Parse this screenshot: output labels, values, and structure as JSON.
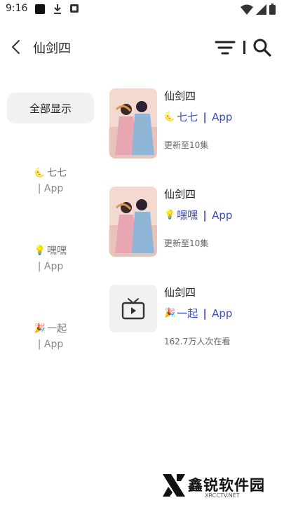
{
  "status_bar": {
    "time": "9:16"
  },
  "header": {
    "title": "仙剑四",
    "icons": [
      "back-arrow-icon",
      "filter-icon",
      "search-icon"
    ]
  },
  "sidebar": {
    "all_label": "全部显示",
    "items": [
      {
        "name": "七七",
        "app": "App",
        "icon": "moon-icon"
      },
      {
        "name": "嘿嘿",
        "app": "App",
        "icon": "bulb-icon"
      },
      {
        "name": "一起",
        "app": "App",
        "icon": "party-popper-icon"
      }
    ]
  },
  "results": [
    {
      "title": "仙剑四",
      "source": "七七",
      "app": "App",
      "meta": "更新至10集",
      "icon": "moon-icon"
    },
    {
      "title": "仙剑四",
      "source": "嘿嘿",
      "app": "App",
      "meta": "更新至10集",
      "icon": "bulb-icon"
    },
    {
      "title": "仙剑四",
      "source": "一起",
      "app": "App",
      "meta": "162.7万人次在看",
      "icon": "party-popper-icon"
    }
  ],
  "watermark": {
    "name": "鑫锐软件园",
    "url": "XRCCTV.NET"
  },
  "colors": {
    "accent": "#3d4bb3",
    "sidebar_bg": "#f1f1f3"
  }
}
